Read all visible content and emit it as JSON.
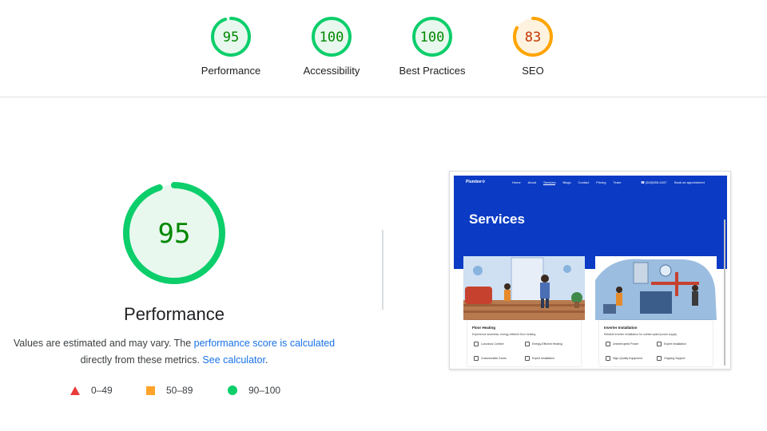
{
  "categories": [
    {
      "score": "95",
      "label": "Performance",
      "fraction": 0.95,
      "status": "pass"
    },
    {
      "score": "100",
      "label": "Accessibility",
      "fraction": 1.0,
      "status": "pass"
    },
    {
      "score": "100",
      "label": "Best Practices",
      "fraction": 1.0,
      "status": "pass"
    },
    {
      "score": "83",
      "label": "SEO",
      "fraction": 0.83,
      "status": "average"
    }
  ],
  "colors": {
    "pass": "#0cce6b",
    "pass_bg": "#e8f8ee",
    "pass_text": "#008800",
    "average": "#ffa400",
    "average_bg": "#fff3e0",
    "average_text": "#c33300",
    "fail": "#ff3333",
    "link": "#1a73e8"
  },
  "main": {
    "score": "95",
    "fraction": 0.95,
    "title": "Performance",
    "desc_part1": "Values are estimated and may vary. The ",
    "desc_link1": "performance score is calculated",
    "desc_part2": "directly from these metrics. ",
    "desc_link2": "See calculator",
    "desc_part3": "."
  },
  "legend": {
    "fail": "0–49",
    "average": "50–89",
    "pass": "90–100"
  },
  "thumbnail": {
    "logo": "Plumber⚙",
    "nav": [
      "Home",
      "About",
      "Services",
      "Blogs",
      "Contact",
      "Pricing",
      "Team"
    ],
    "active_nav": "Services",
    "phone": "☎ (843)555-0437",
    "cta": "Book an appointment",
    "heading": "Services",
    "cards": [
      {
        "title": "Floor Heating",
        "subtitle": "Experience seamless, energy-efficient floor heating",
        "features": [
          "Luxurious Comfort",
          "Energy-Efficient Heating",
          "Customizable Zones",
          "Expert Installation"
        ]
      },
      {
        "title": "Inverter Installation",
        "subtitle": "Reliable inverter installation for uninterrupted power supply",
        "features": [
          "Uninterrupted Power",
          "Expert Installation",
          "High-Quality Equipment",
          "Ongoing Support"
        ]
      }
    ]
  }
}
